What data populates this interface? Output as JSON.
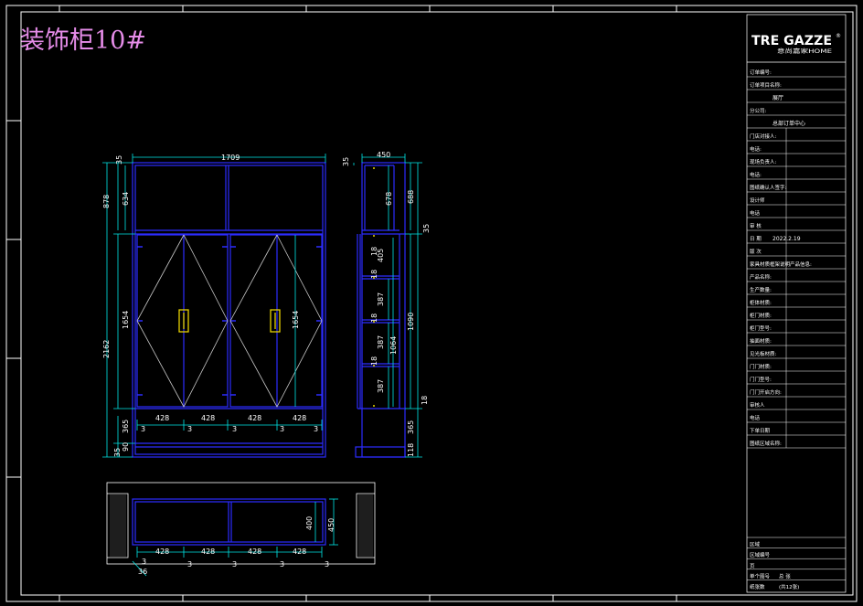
{
  "drawing_title": "装饰柜10#",
  "brand": {
    "logo_main": "TRE GAZZE",
    "logo_mark": "®",
    "logo_sub": "意尚嘉家HOME"
  },
  "title_block": {
    "rows": [
      {
        "label": "订单编号:",
        "value": ""
      },
      {
        "label": "订单项目名称:",
        "value": ""
      },
      {
        "label": "",
        "value": "展厅"
      },
      {
        "label": "分公司:",
        "value": ""
      },
      {
        "label": "",
        "value": "总部订单中心"
      },
      {
        "label": "门店对接人:",
        "value": ""
      },
      {
        "label": "电话:",
        "value": ""
      },
      {
        "label": "现场负责人:",
        "value": ""
      },
      {
        "label": "电话:",
        "value": ""
      },
      {
        "label": "图纸确认人签字:",
        "value": ""
      },
      {
        "label": "设计师",
        "value": ""
      },
      {
        "label": "电话",
        "value": ""
      },
      {
        "label": "审 核",
        "value": ""
      },
      {
        "label": "日 期",
        "value": "2022.2.19"
      },
      {
        "label": "版 次",
        "value": ""
      },
      {
        "label": "家具材质框架说明产品信息:",
        "value": ""
      },
      {
        "label": "产品名称:",
        "value": ""
      },
      {
        "label": "生产数量:",
        "value": ""
      },
      {
        "label": "柜体材质:",
        "value": ""
      },
      {
        "label": "柜门材质:",
        "value": ""
      },
      {
        "label": "柜门型号:",
        "value": ""
      },
      {
        "label": "抽面材质:",
        "value": ""
      },
      {
        "label": "见光板材质:",
        "value": ""
      },
      {
        "label": "门门材质:",
        "value": ""
      },
      {
        "label": "门门型号:",
        "value": ""
      },
      {
        "label": "门门开启方向:",
        "value": ""
      },
      {
        "label": "审核人",
        "value": ""
      },
      {
        "label": "电话",
        "value": ""
      },
      {
        "label": "下单日期",
        "value": ""
      },
      {
        "label": "图纸区域名称:",
        "value": ""
      }
    ],
    "bottom_rows": [
      {
        "label": "区域",
        "value": ""
      },
      {
        "label": "区域编号",
        "value": ""
      },
      {
        "label": "页",
        "value": ""
      },
      {
        "label": "单个图号",
        "value": "总 张"
      },
      {
        "label": "纸张数",
        "value": "(共12张)"
      }
    ]
  },
  "dimensions": {
    "front_width": "1709",
    "front_top_gap": "35",
    "front_upper_left": "878",
    "front_upper_inner": "634",
    "front_total_height": "2162",
    "front_door_height": "1654",
    "front_door_height_right": "1654",
    "front_bottom_a": "365",
    "front_bottom_b": "90",
    "front_bottom_c": "35",
    "front_door_widths": [
      "428",
      "428",
      "428",
      "428"
    ],
    "front_gap": "3",
    "side_depth": "450",
    "side_top": "35",
    "side_upper_inner": "678",
    "side_upper_outer": "688",
    "side_mid_gap": "35",
    "side_shelf_thk": "18",
    "side_shelf_1": "405",
    "side_shelf_2": "387",
    "side_shelf_3": "387",
    "side_shelf_4": "387",
    "side_lower_total": "1090",
    "side_lower_inner": "1064",
    "side_bottom_a": "18",
    "side_bottom_b": "365",
    "side_bottom_c": "118",
    "plan_depth_inner": "400",
    "plan_depth_outer": "450",
    "plan_widths": [
      "428",
      "428",
      "428",
      "428"
    ],
    "plan_side": "36"
  },
  "colors": {
    "frame": "#ffffff",
    "carcass": "#2c2cff",
    "dimension": "#00e6e6",
    "door_line": "#c8c8c8",
    "handle": "#e6d200",
    "title": "#e58ce8"
  }
}
